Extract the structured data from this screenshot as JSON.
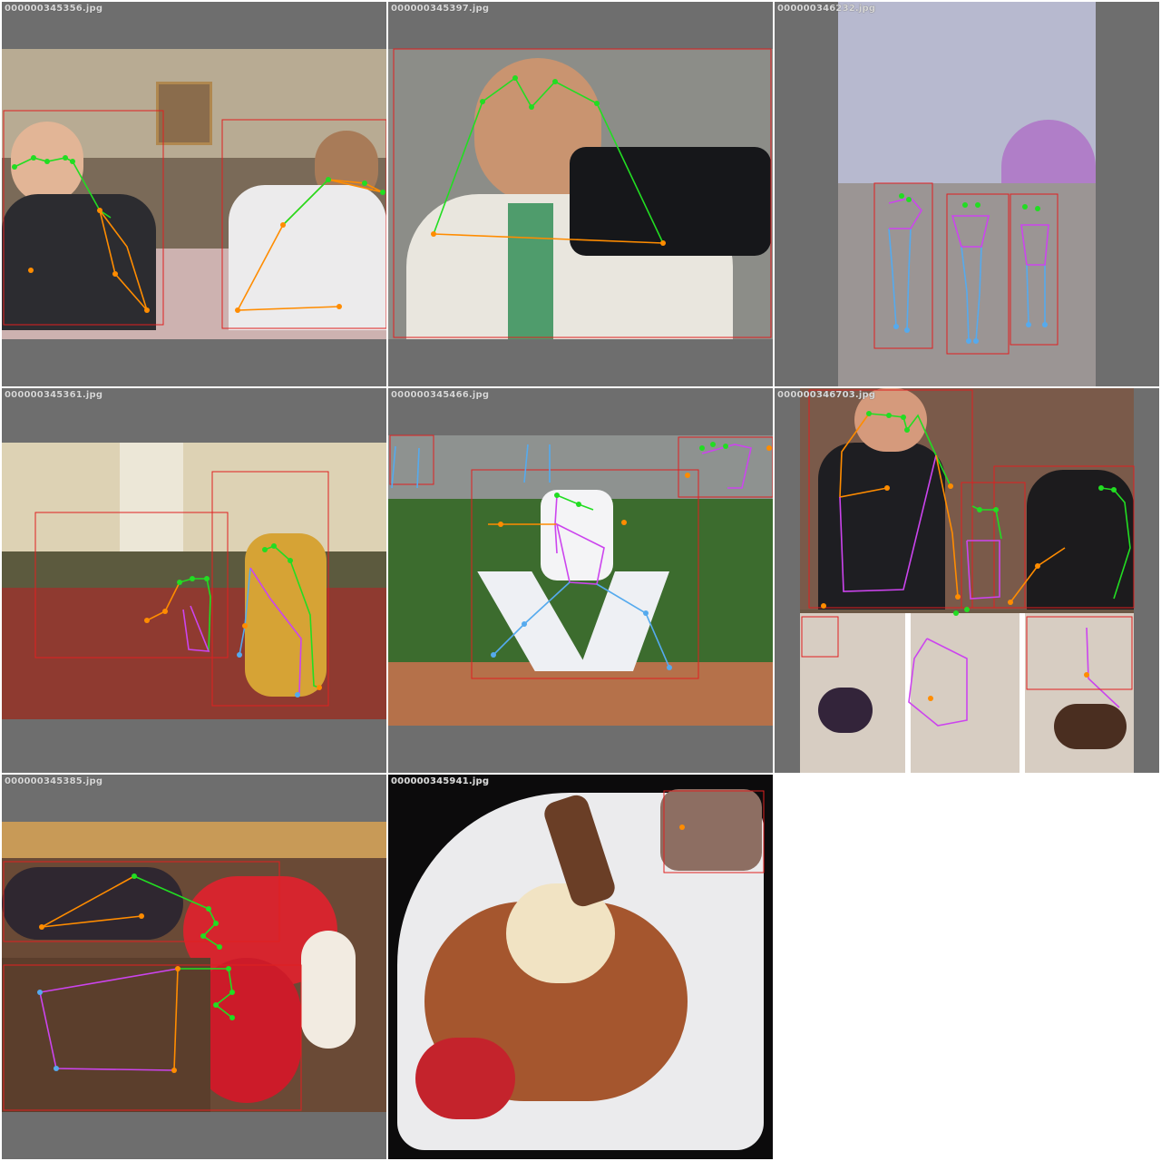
{
  "grid": {
    "tiles": [
      {
        "filename": "000000345356.jpg"
      },
      {
        "filename": "000000345397.jpg"
      },
      {
        "filename": "000000346232.jpg"
      },
      {
        "filename": "000000345361.jpg"
      },
      {
        "filename": "000000345466.jpg"
      },
      {
        "filename": "000000346703.jpg"
      },
      {
        "filename": "000000345385.jpg"
      },
      {
        "filename": "000000345941.jpg"
      }
    ]
  },
  "colors": {
    "background": "#6e6e6e",
    "bbox": "#e02020",
    "head_limb": "#22dd22",
    "left_limb": "#ff8c00",
    "right_limb": "#cc44ee",
    "legs": "#55aaee"
  }
}
